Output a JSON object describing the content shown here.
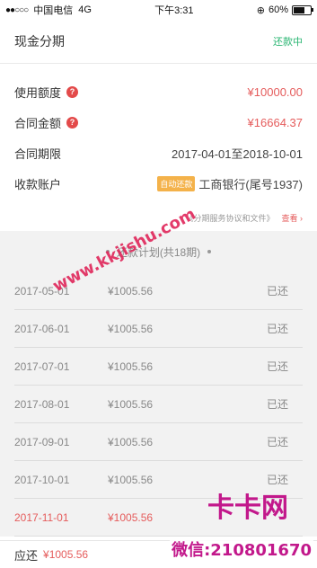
{
  "statusbar": {
    "carrier": "中国电信",
    "network": "4G",
    "time": "下午3:31",
    "battery": "60%"
  },
  "header": {
    "title": "现金分期",
    "status": "还款中"
  },
  "details": {
    "limit_label": "使用额度",
    "limit_value": "¥10000.00",
    "contract_amount_label": "合同金额",
    "contract_amount_value": "¥16664.37",
    "term_label": "合同期限",
    "term_value": "2017-04-01至2018-10-01",
    "account_label": "收款账户",
    "account_badge": "自动还款",
    "account_value": "工商银行(尾号1937)"
  },
  "agreement": {
    "text": "《分期服务协议和文件》",
    "view_label": "查看",
    "view_icon": "chevron-right-icon"
  },
  "plan": {
    "title": "还款计划(共18期)",
    "rows": [
      {
        "date": "2017-05-01",
        "amount": "¥1005.56",
        "status": "已还"
      },
      {
        "date": "2017-06-01",
        "amount": "¥1005.56",
        "status": "已还"
      },
      {
        "date": "2017-07-01",
        "amount": "¥1005.56",
        "status": "已还"
      },
      {
        "date": "2017-08-01",
        "amount": "¥1005.56",
        "status": "已还"
      },
      {
        "date": "2017-09-01",
        "amount": "¥1005.56",
        "status": "已还"
      },
      {
        "date": "2017-10-01",
        "amount": "¥1005.56",
        "status": "已还"
      },
      {
        "date": "2017-11-01",
        "amount": "¥1005.56",
        "status": ""
      }
    ]
  },
  "footer": {
    "label": "应还",
    "amount": "¥1005.56"
  },
  "watermarks": {
    "url": "www.kkjishu.com",
    "brand": "卡卡网",
    "wechat": "微信:210801670"
  },
  "colors": {
    "accent_red": "#e55c5c",
    "status_green": "#2bb673",
    "badge_orange": "#f4b24a",
    "watermark_pink": "#e0265a",
    "stamp_magenta": "#c2188b"
  }
}
